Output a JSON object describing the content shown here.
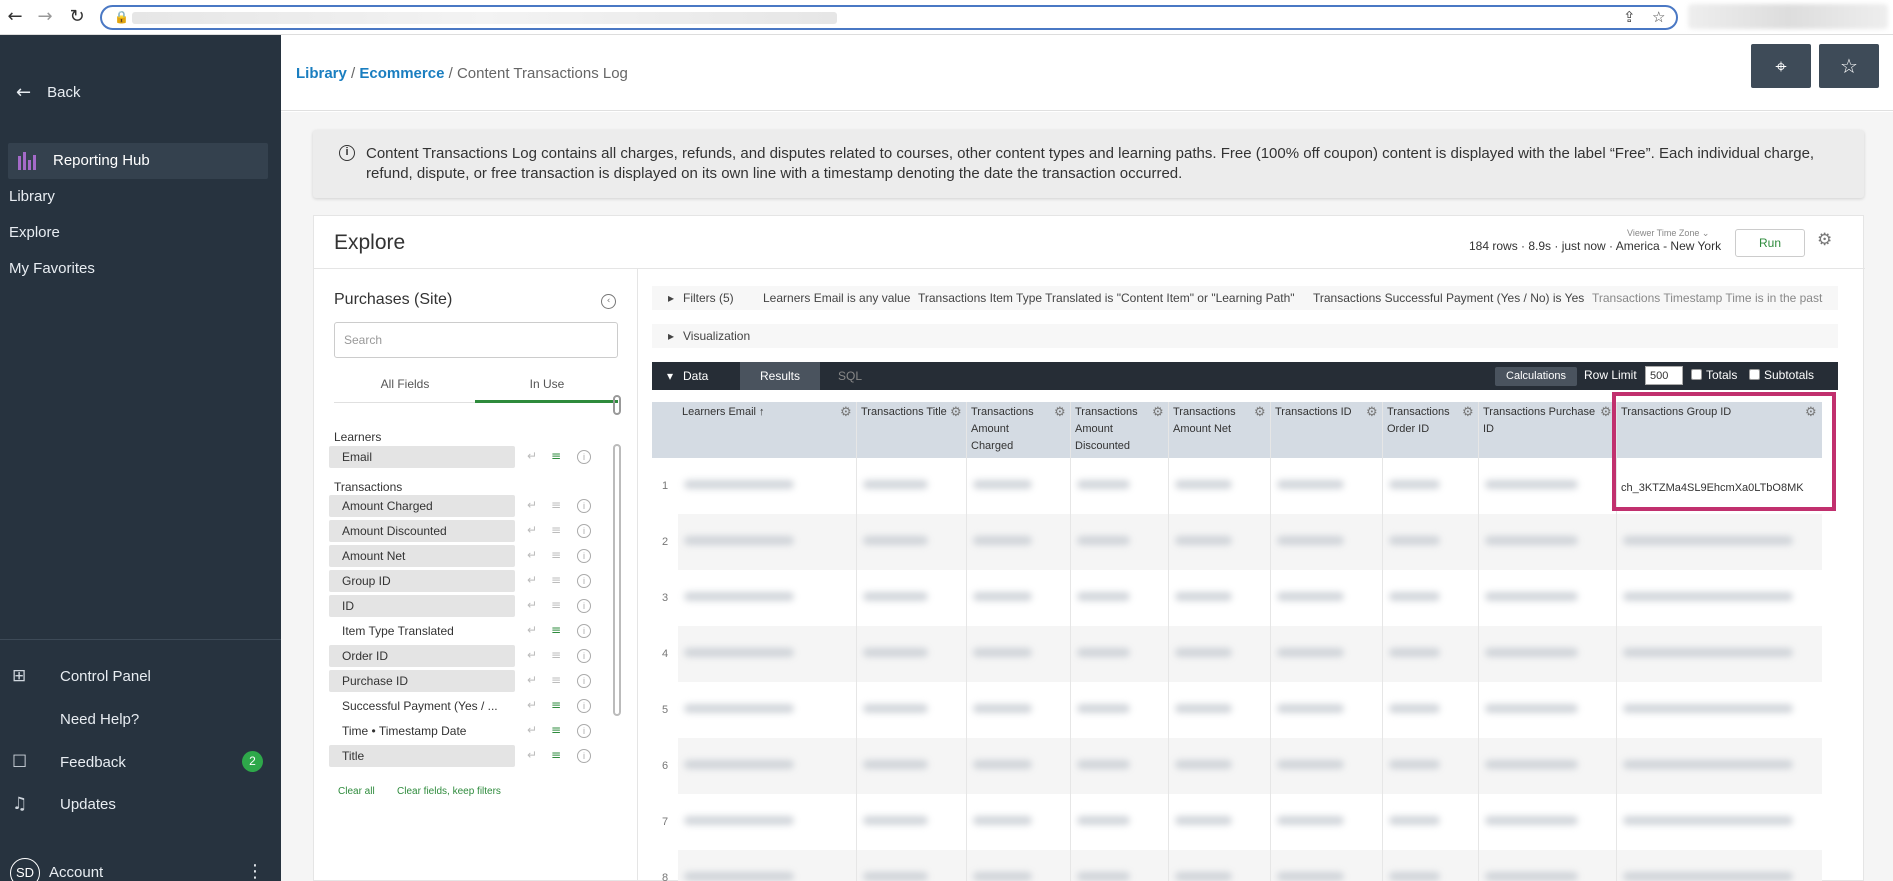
{
  "browser": {
    "back_glyph": "←",
    "forward_glyph": "→",
    "reload_glyph": "↻",
    "lock_glyph": "🔒",
    "share_glyph": "⇪",
    "star_glyph": "☆"
  },
  "sidebar": {
    "back_label": "Back",
    "nav": [
      {
        "label": "Reporting Hub",
        "active": true
      },
      {
        "label": "Library"
      },
      {
        "label": "Explore"
      },
      {
        "label": "My Favorites"
      }
    ],
    "bottom": [
      {
        "label": "Control Panel",
        "icon": "grid-icon"
      },
      {
        "label": "Need Help?",
        "icon": ""
      },
      {
        "label": "Feedback",
        "icon": "chat-icon"
      },
      {
        "label": "Updates",
        "icon": "bell-icon"
      }
    ],
    "feedback_badge": "2",
    "account_initials": "SD",
    "account_label": "Account",
    "colors": {
      "background": "#27333f",
      "accent": "#a46ac8",
      "badge": "#2ea84a"
    }
  },
  "header": {
    "breadcrumb": {
      "library": "Library",
      "ecommerce": "Ecommerce",
      "current": "Content Transactions Log",
      "separator": " / "
    },
    "location_glyph": "⌖",
    "star_glyph": "☆"
  },
  "info": {
    "text": "Content Transactions Log contains all charges, refunds, and disputes related to courses, other content types and learning paths. Free (100% off coupon) content is displayed with the label “Free”. Each individual charge, refund, dispute, or free transaction is displayed on its own line with a timestamp denoting the date the transaction occurred."
  },
  "explore": {
    "title": "Explore",
    "timezone_label": "Viewer Time Zone ⌄",
    "meta": "184 rows · 8.9s · just now · America - New York",
    "run_label": "Run"
  },
  "picker": {
    "title": "Purchases (Site)",
    "search_placeholder": "Search",
    "tabs": [
      "All Fields",
      "In Use"
    ],
    "groups": [
      {
        "label": "Learners",
        "fields": [
          {
            "name": "Email",
            "in_use": true,
            "filtered": true
          }
        ]
      },
      {
        "label": "Transactions",
        "fields": [
          {
            "name": "Amount Charged",
            "in_use": true,
            "filtered": false
          },
          {
            "name": "Amount Discounted",
            "in_use": true,
            "filtered": false
          },
          {
            "name": "Amount Net",
            "in_use": true,
            "filtered": false
          },
          {
            "name": "Group ID",
            "in_use": true,
            "filtered": false
          },
          {
            "name": "ID",
            "in_use": true,
            "filtered": false
          },
          {
            "name": "Item Type Translated",
            "in_use": false,
            "filtered": true
          },
          {
            "name": "Order ID",
            "in_use": true,
            "filtered": false
          },
          {
            "name": "Purchase ID",
            "in_use": true,
            "filtered": false
          },
          {
            "name": "Successful Payment (Yes / ...",
            "in_use": false,
            "filtered": true
          },
          {
            "name": "Time • Timestamp Date",
            "in_use": false,
            "filtered": true
          },
          {
            "name": "Title",
            "in_use": true,
            "filtered": true
          }
        ]
      }
    ],
    "clear_all": "Clear all",
    "clear_keep": "Clear fields, keep filters"
  },
  "query": {
    "filters_label": "Filters (5)",
    "filters": [
      "Learners Email is any value",
      "Transactions Item Type Translated is \"Content Item\" or \"Learning Path\"",
      "Transactions Successful Payment (Yes / No) is Yes",
      "Transactions Timestamp Time is in the past"
    ],
    "visualization_label": "Visualization",
    "data_label": "Data",
    "results_label": "Results",
    "sql_label": "SQL",
    "calculations_label": "Calculations",
    "row_limit_label": "Row Limit",
    "row_limit_value": "500",
    "totals_label": "Totals",
    "subtotals_label": "Subtotals"
  },
  "grid": {
    "columns": [
      {
        "label": "Learners Email ↑"
      },
      {
        "label": "Transactions Title"
      },
      {
        "label": "Transactions Amount Charged"
      },
      {
        "label": "Transactions Amount Discounted"
      },
      {
        "label": "Transactions Amount Net"
      },
      {
        "label": "Transactions ID"
      },
      {
        "label": "Transactions Order ID"
      },
      {
        "label": "Transactions Purchase ID"
      },
      {
        "label": "Transactions Group ID"
      }
    ],
    "row_numbers": [
      "1",
      "2",
      "3",
      "4",
      "5",
      "6",
      "7",
      "8"
    ],
    "group_id_value": "ch_3KTZMa4SL9EhcmXa0LTbO8MK",
    "highlight_color": "#c1306e"
  }
}
